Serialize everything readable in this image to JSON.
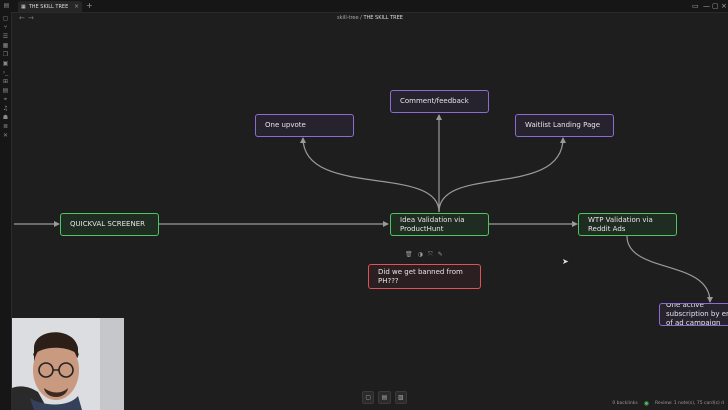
{
  "tab": {
    "title": "THE SKILL TREE",
    "close": "×",
    "new": "+"
  },
  "nav": {
    "back": "←",
    "forward": "→"
  },
  "breadcrumb": {
    "folder": "skill-tree",
    "separator": "/",
    "current": "THE SKILL TREE"
  },
  "window_controls": [
    "▭",
    "—",
    "▢",
    "×"
  ],
  "sidebar_icons": [
    "file-icon",
    "graph-icon",
    "list-icon",
    "calendar-icon",
    "copy-icon",
    "template-icon",
    "terminal-icon",
    "canvas-icon",
    "bookmark-icon",
    "tag-icon",
    "audio-icon",
    "robot-icon",
    "stack-icon",
    "settings-icon"
  ],
  "nodes": {
    "quickval": "QUICKVAL SCREENER",
    "idea_validation": "Idea Validation via ProductHunt",
    "wtp_validation": "WTP Validation via Reddit Ads",
    "one_upvote": "One upvote",
    "comment_feedback": "Comment/feedback",
    "waitlist": "Waitlist Landing Page",
    "banned_ph": "Did we get banned from PH???",
    "active_subscription": "One active subscription by end of ad campaign"
  },
  "node_toolbar": [
    "🗑",
    "◑",
    "⤧",
    "✎"
  ],
  "status": {
    "backlinks": "0 backlinks",
    "review": "Review: 1 note(s), 75 card(s) d"
  },
  "colors": {
    "purple": "#8a6dcc",
    "green": "#4fc45f",
    "red": "#e0525a",
    "edge": "#9a9a9a"
  }
}
